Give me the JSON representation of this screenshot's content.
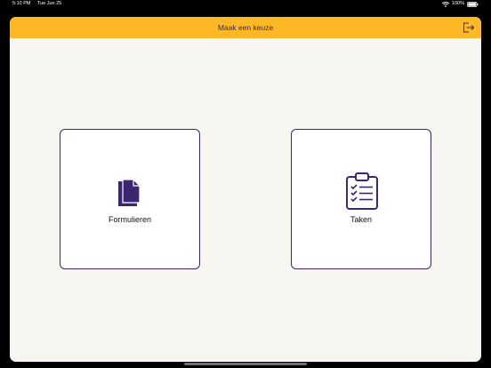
{
  "status_bar": {
    "time": "5:10 PM",
    "date": "Tue Jun 25",
    "battery": "100%"
  },
  "nav": {
    "title": "Maak een keuze",
    "logout_icon": "logout-icon"
  },
  "tiles": [
    {
      "label": "Formulieren",
      "icon": "documents-icon"
    },
    {
      "label": "Taken",
      "icon": "clipboard-checklist-icon"
    }
  ],
  "colors": {
    "nav_background": "#fdb826",
    "accent_purple": "#3b2670",
    "page_background": "#f7f6f1"
  }
}
